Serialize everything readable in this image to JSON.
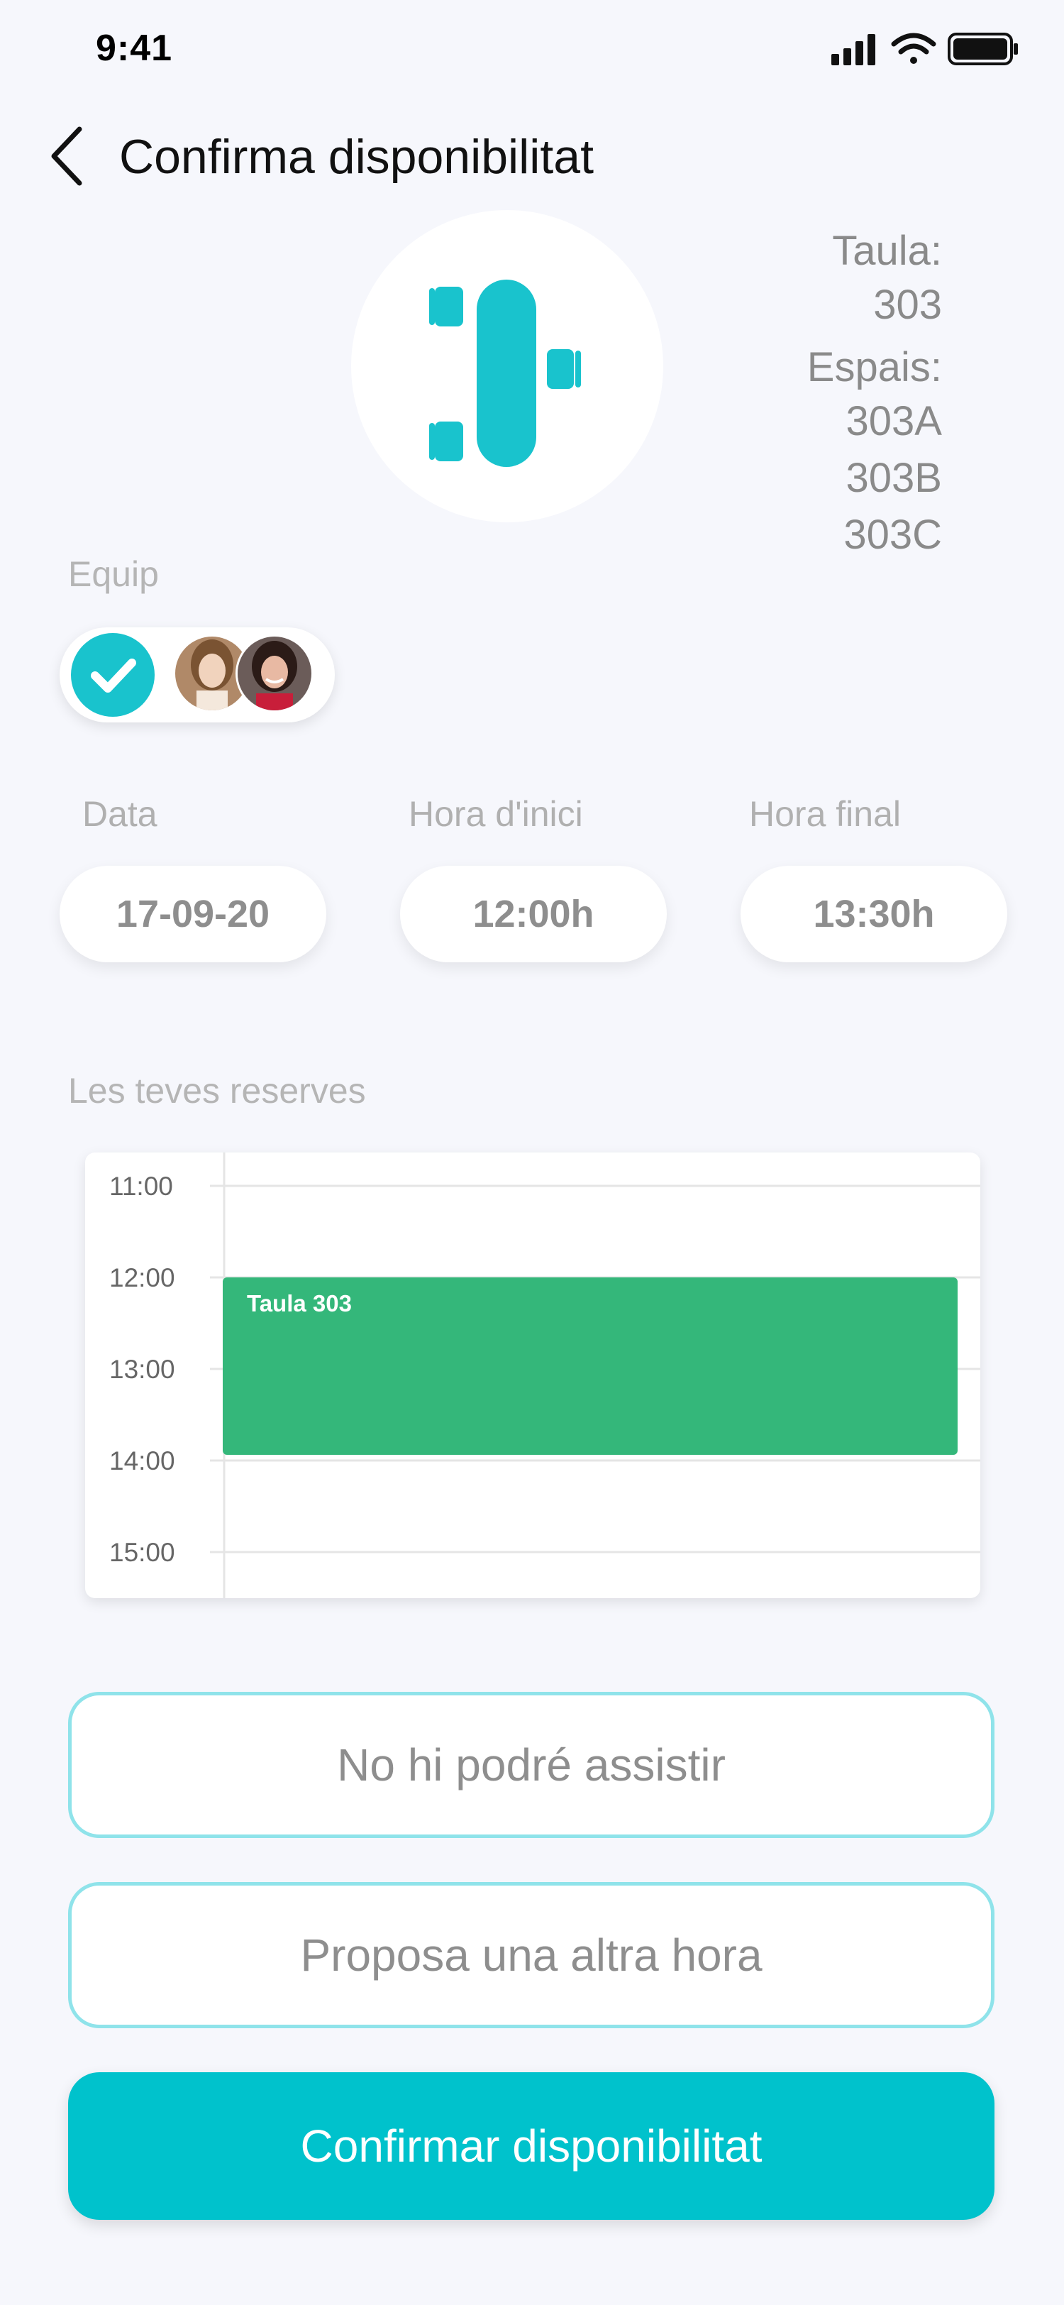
{
  "status_bar": {
    "time": "9:41"
  },
  "header": {
    "title": "Confirma disponibilitat"
  },
  "desk_info": {
    "table_label": "Taula:",
    "table_value": "303",
    "spaces_label": "Espais:",
    "spaces": [
      "303A",
      "303B",
      "303C"
    ]
  },
  "team": {
    "label": "Equip"
  },
  "fields": {
    "date_label": "Data",
    "date_value": "17-09-20",
    "start_label": "Hora d'inici",
    "start_value": "12:00h",
    "end_label": "Hora final",
    "end_value": "13:30h"
  },
  "reservations": {
    "label": "Les teves reserves",
    "hours": [
      "11:00",
      "12:00",
      "13:00",
      "14:00",
      "15:00"
    ],
    "event_title": "Taula 303",
    "event_color": "#34b77a"
  },
  "buttons": {
    "decline": "No hi podré assistir",
    "propose": "Proposa una altra hora",
    "confirm": "Confirmar disponibilitat"
  },
  "colors": {
    "accent": "#00c2cc",
    "outline": "#8fe3ea",
    "background": "#f6f7fc"
  }
}
